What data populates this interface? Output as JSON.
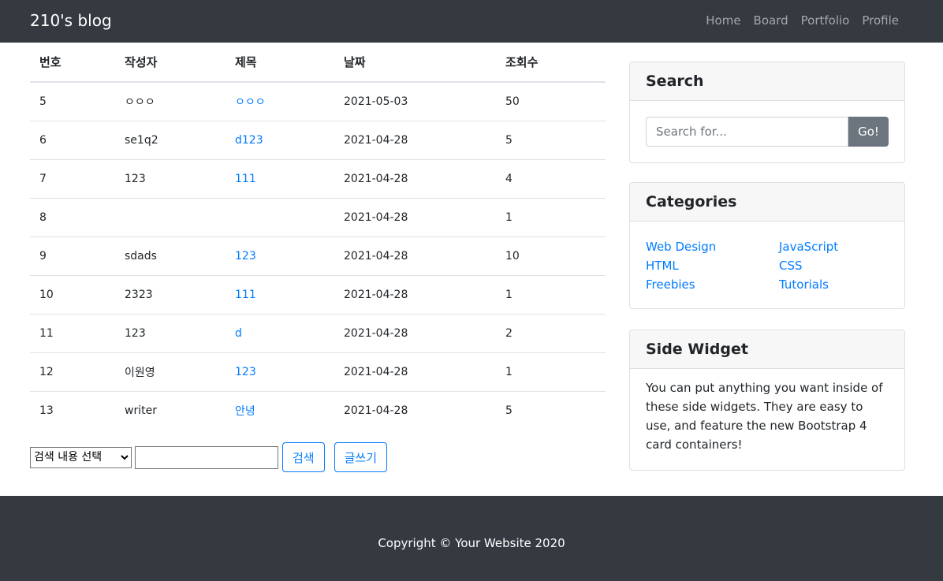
{
  "navbar": {
    "brand": "210's blog",
    "links": [
      "Home",
      "Board",
      "Portfolio",
      "Profile"
    ]
  },
  "board": {
    "headers": [
      "번호",
      "작성자",
      "제목",
      "날짜",
      "조회수"
    ],
    "rows": [
      [
        "5",
        "ㅇㅇㅇ",
        "ㅇㅇㅇ",
        "2021-05-03",
        "50"
      ],
      [
        "6",
        "se1q2",
        "d123",
        "2021-04-28",
        "5"
      ],
      [
        "7",
        "123",
        "111",
        "2021-04-28",
        "4"
      ],
      [
        "8",
        "",
        "",
        "2021-04-28",
        "1"
      ],
      [
        "9",
        "sdads",
        "123",
        "2021-04-28",
        "10"
      ],
      [
        "10",
        "2323",
        "111",
        "2021-04-28",
        "1"
      ],
      [
        "11",
        "123",
        "d",
        "2021-04-28",
        "2"
      ],
      [
        "12",
        "이원영",
        "123",
        "2021-04-28",
        "1"
      ],
      [
        "13",
        "writer",
        "안녕",
        "2021-04-28",
        "5"
      ]
    ],
    "search_select": "검색 내용 선택",
    "search_value": "",
    "search_button": "검색",
    "write_button": "글쓰기"
  },
  "sidebar": {
    "search": {
      "title": "Search",
      "placeholder": "Search for...",
      "button": "Go!"
    },
    "categories": {
      "title": "Categories",
      "items": [
        "Web Design",
        "JavaScript",
        "HTML",
        "CSS",
        "Freebies",
        "Tutorials"
      ]
    },
    "widget": {
      "title": "Side Widget",
      "text": "You can put anything you want inside of these side widgets. They are easy to use, and feature the new Bootstrap 4 card containers!"
    }
  },
  "footer": {
    "text": "Copyright © Your Website 2020"
  },
  "colors": {
    "navbar_bg": "#343a40",
    "link": "#007bff",
    "go_button": "#6c757d"
  }
}
